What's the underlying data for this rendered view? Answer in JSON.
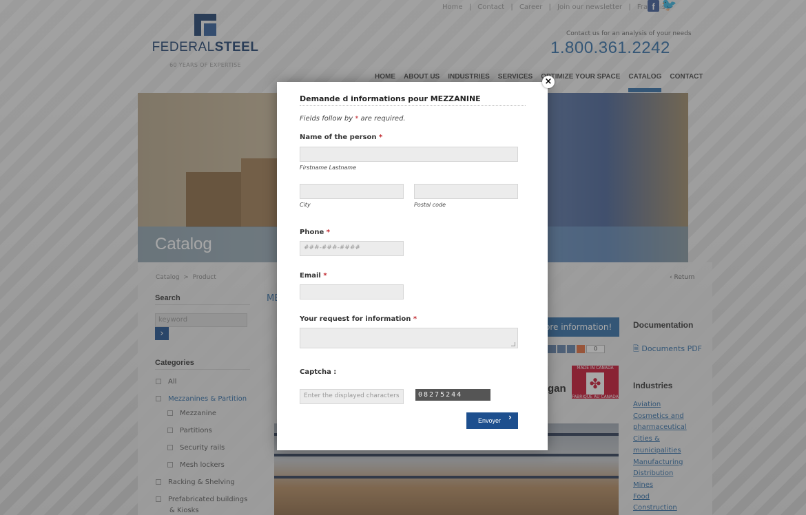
{
  "topnav": {
    "links": [
      "Home",
      "Contact",
      "Career",
      "Join our newsletter",
      "Français"
    ],
    "separator": "|"
  },
  "social": {
    "facebook_icon": "facebook-icon",
    "twitter_icon": "twitter-icon"
  },
  "logo": {
    "brand_light": "FEDERAL",
    "brand_bold": "STEEL",
    "tagline": "60 YEARS OF EXPERTISE"
  },
  "header": {
    "contact_text": "Contact us for an analysis of your needs",
    "phone": "1.800.361.2242"
  },
  "mainnav": {
    "items": [
      "HOME",
      "ABOUT US",
      "INDUSTRIES",
      "SERVICES",
      "OPTIMIZE YOUR SPACE",
      "CATALOG",
      "CONTACT"
    ],
    "active": "CATALOG"
  },
  "hero": {
    "title": "Catalog"
  },
  "breadcrumb": {
    "root": "Catalog",
    "sep": ">",
    "current": "Product"
  },
  "return_label": "Return",
  "sidebar": {
    "search_heading": "Search",
    "search_placeholder": "keyword",
    "categories_heading": "Categories",
    "categories": [
      "All",
      "Mezzanines & Partition",
      "Mezzanine",
      "Partitions",
      "Security rails",
      "Mesh lockers",
      "Racking & Shelving",
      "Prefabricated buildings",
      "& Kiosks"
    ]
  },
  "product": {
    "title_partial": "ME",
    "more_info_button": "ore information!",
    "share_count": "0",
    "brand_partial": "gan",
    "made_in_canada_top": "MADE IN CANADA",
    "made_in_canada_bottom": "FABRIQUÉ AU CANADA"
  },
  "right_col": {
    "documentation_heading": "Documentation",
    "documents_link": "Documents PDF",
    "industries_heading": "Industries",
    "industries": [
      "Aviation",
      "Cosmetics and",
      "pharmaceutical",
      "Cities &",
      "municipalities",
      "Manufacturing",
      "Distribution",
      "Mines",
      "Food",
      "Construction"
    ]
  },
  "modal": {
    "title": "Demande d informations pour MEZZANINE",
    "note_prefix": "Fields follow by",
    "note_star": "*",
    "note_suffix": "are required.",
    "name_label": "Name of the person",
    "name_hint": "Firstname Lastname",
    "city_hint": "City",
    "postal_hint": "Postal code",
    "phone_label": "Phone",
    "phone_placeholder": "###-###-####",
    "email_label": "Email",
    "request_label": "Your request for information",
    "captcha_label": "Captcha :",
    "captcha_placeholder": "Enter the displayed characters",
    "captcha_image_text": "08275244",
    "send_button": "Envoyer",
    "close_label": "×",
    "required_star": "*"
  },
  "colors": {
    "accent": "#2e6ca6",
    "button": "#1d4f8e",
    "required": "#c0262c"
  }
}
